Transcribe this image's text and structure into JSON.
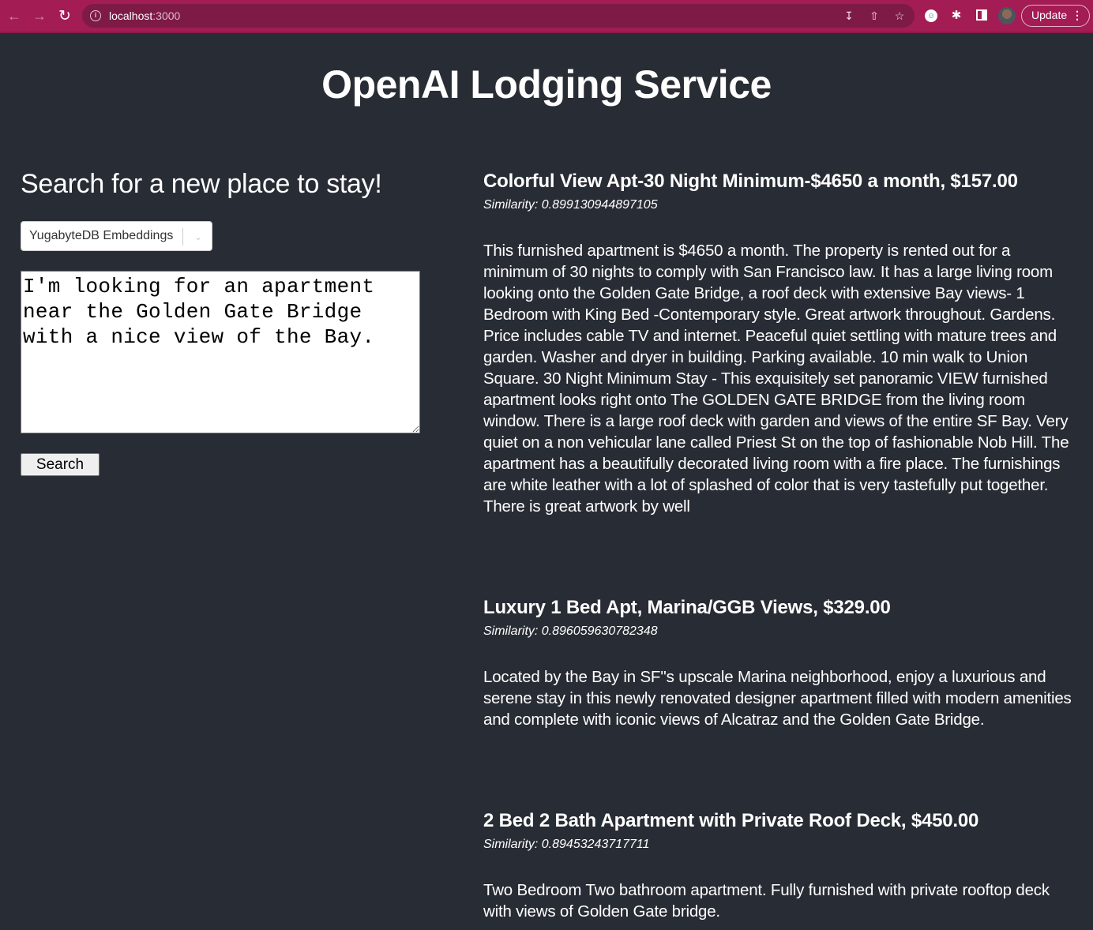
{
  "browser": {
    "url_host": "localhost",
    "url_port": ":3000",
    "update_label": "Update",
    "icons": [
      "back-arrow-icon",
      "forward-arrow-icon",
      "reload-icon",
      "info-icon",
      "install-app-icon",
      "share-icon",
      "bookmark-star-icon",
      "extension-icon",
      "puzzle-extensions-icon",
      "side-panel-icon",
      "profile-avatar",
      "more-menu-icon"
    ]
  },
  "page": {
    "title": "OpenAI Lodging Service"
  },
  "search": {
    "heading": "Search for a new place to stay!",
    "source_selected": "YugabyteDB Embeddings",
    "query": "I'm looking for an apartment near the Golden Gate Bridge with a nice view of the Bay.",
    "button_label": "Search"
  },
  "results": [
    {
      "title": "Colorful View Apt-30 Night Minimum-$4650 a month, $157.00",
      "similarity": "Similarity: 0.899130944897105",
      "description": "This furnished apartment is $4650 a month. The property is rented out for a minimum of 30 nights to comply with San Francisco law. It has a large living room looking onto the Golden Gate Bridge, a roof deck with extensive Bay views- 1 Bedroom with King Bed -Contemporary style. Great artwork throughout. Gardens. Price includes cable TV and internet. Peaceful quiet settling with mature trees and garden. Washer and dryer in building. Parking available. 10 min walk to Union Square. 30 Night Minimum Stay - This exquisitely set panoramic VIEW furnished apartment looks right onto The GOLDEN GATE BRIDGE from the living room window. There is a large roof deck with garden and views of the entire SF Bay. Very quiet on a non vehicular lane called Priest St on the top of fashionable Nob Hill. The apartment has a beautifully decorated living room with a fire place. The furnishings are white leather with a lot of splashed of color that is very tastefully put together. There is great artwork by well"
    },
    {
      "title": "Luxury 1 Bed Apt, Marina/GGB Views, $329.00",
      "similarity": "Similarity: 0.896059630782348",
      "description": "Located by the Bay in SF''s upscale Marina neighborhood, enjoy a luxurious and serene stay in this newly renovated designer apartment filled with modern amenities and complete with iconic views of Alcatraz and the Golden Gate Bridge."
    },
    {
      "title": "2 Bed 2 Bath Apartment with Private Roof Deck, $450.00",
      "similarity": "Similarity: 0.89453243717711",
      "description": "Two Bedroom Two bathroom apartment. Fully furnished with private rooftop deck with views of Golden Gate bridge."
    }
  ]
}
